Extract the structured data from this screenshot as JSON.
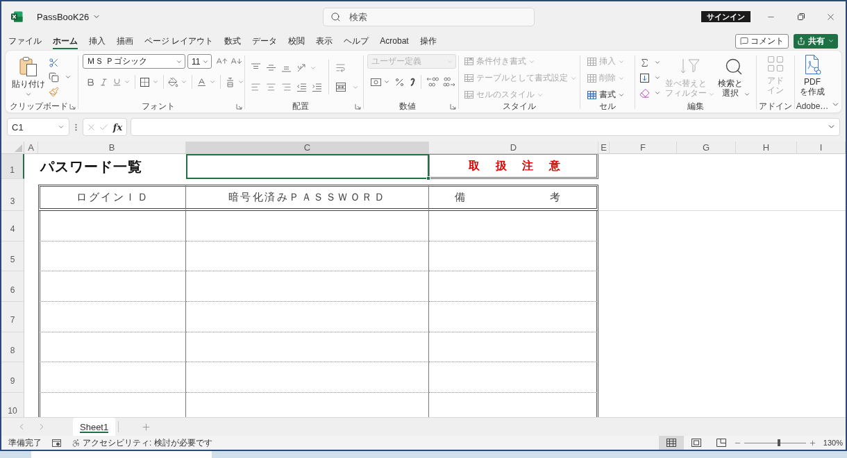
{
  "window": {
    "file_name": "PassBooK26",
    "search_placeholder": "検索",
    "sign_in": "サインイン"
  },
  "menu_tabs": [
    {
      "label": "ファイル",
      "selected": false
    },
    {
      "label": "ホーム",
      "selected": true
    },
    {
      "label": "挿入",
      "selected": false
    },
    {
      "label": "描画",
      "selected": false
    },
    {
      "label": "ページ レイアウト",
      "selected": false
    },
    {
      "label": "数式",
      "selected": false
    },
    {
      "label": "データ",
      "selected": false
    },
    {
      "label": "校閲",
      "selected": false
    },
    {
      "label": "表示",
      "selected": false
    },
    {
      "label": "ヘルプ",
      "selected": false
    },
    {
      "label": "Acrobat",
      "selected": false
    },
    {
      "label": "操作",
      "selected": false
    }
  ],
  "actions": {
    "comment": "コメント",
    "share": "共有"
  },
  "ribbon": {
    "groups": [
      {
        "kind": "clipboard",
        "label": "クリップボード",
        "launcher": true,
        "paste": "貼り付け"
      },
      {
        "kind": "font",
        "label": "フォント",
        "launcher": true,
        "font_name": "ＭＳ Ｐゴシック",
        "font_size": "11"
      },
      {
        "kind": "alignment",
        "label": "配置",
        "launcher": true
      },
      {
        "kind": "number",
        "label": "数値",
        "launcher": true,
        "format": {
          "value": "ユーザー定義",
          "disabled": true
        }
      },
      {
        "kind": "styles",
        "label": "スタイル",
        "launcher": false,
        "items": [
          {
            "label": "条件付き書式",
            "disabled": true
          },
          {
            "label": "テーブルとして書式設定",
            "disabled": true
          },
          {
            "label": "セルのスタイル",
            "disabled": true
          }
        ]
      },
      {
        "kind": "cells",
        "label": "セル",
        "launcher": false,
        "items": [
          {
            "label": "挿入",
            "disabled": true
          },
          {
            "label": "削除",
            "disabled": true
          },
          {
            "label": "書式",
            "disabled": false
          }
        ]
      },
      {
        "kind": "editing",
        "label": "編集",
        "launcher": false,
        "buttons": [
          {
            "label": "並べ替えとフィルター",
            "disabled": true
          },
          {
            "label": "検索と選択",
            "disabled": false
          }
        ]
      },
      {
        "kind": "addins",
        "label": "アドイン",
        "launcher": false,
        "button": {
          "label": "アドイン",
          "disabled": true
        }
      },
      {
        "kind": "adobe",
        "label": "Adobe…",
        "launcher": false,
        "button": {
          "label": "PDF\nを作成",
          "disabled": false
        }
      }
    ]
  },
  "formula_bar": {
    "name_box": "C1",
    "function_button": "fx"
  },
  "sheet": {
    "columns": [
      {
        "label": "A",
        "selected": false
      },
      {
        "label": "B",
        "selected": false
      },
      {
        "label": "C",
        "selected": true
      },
      {
        "label": "D",
        "selected": false
      },
      {
        "label": "E",
        "selected": false
      },
      {
        "label": "F",
        "selected": false
      },
      {
        "label": "G",
        "selected": false
      },
      {
        "label": "H",
        "selected": false
      },
      {
        "label": "I",
        "selected": false
      }
    ],
    "rows": [
      {
        "kind": "title",
        "number": "1",
        "selected": true,
        "title": "パスワード一覧",
        "notice": "取　扱　注　意"
      },
      {
        "kind": "spacer",
        "selected": false
      },
      {
        "kind": "header",
        "number": "3",
        "selected": false,
        "cells": [
          "ログインＩＤ",
          "暗号化済みＰＡＳＳＷＯＲＤ",
          "備　考"
        ]
      },
      {
        "kind": "body",
        "number": "4",
        "selected": false
      },
      {
        "kind": "body",
        "number": "5",
        "selected": false
      },
      {
        "kind": "body",
        "number": "6",
        "selected": false
      },
      {
        "kind": "body",
        "number": "7",
        "selected": false
      },
      {
        "kind": "body",
        "number": "8",
        "selected": false
      },
      {
        "kind": "body",
        "number": "9",
        "selected": false
      },
      {
        "kind": "body",
        "number": "10",
        "selected": false
      }
    ]
  },
  "sheet_tabs": [
    {
      "label": "Sheet1",
      "selected": true
    }
  ],
  "status_bar": {
    "ready": "準備完了",
    "accessibility": "アクセシビリティ: 検討が必要です",
    "views": [
      {
        "kind": "normal",
        "selected": true
      },
      {
        "kind": "page_layout",
        "selected": false
      },
      {
        "kind": "page_break",
        "selected": false
      }
    ],
    "zoom": {
      "level": 0.56,
      "reading": "130%"
    }
  }
}
